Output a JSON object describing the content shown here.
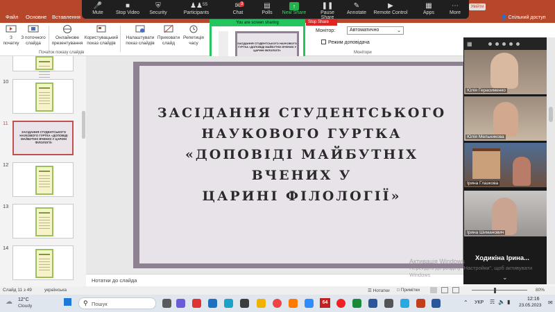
{
  "ribbon": {
    "tabs": [
      "Файл",
      "Основне",
      "Вставлення"
    ],
    "buttons": [
      {
        "label": "З початку"
      },
      {
        "label": "З поточного слайда"
      },
      {
        "label": "Онлайнове презентування"
      },
      {
        "label": "Користувацький показ слайдів"
      },
      {
        "label": "Налаштувати показ слайдів"
      },
      {
        "label": "Приховати слайд"
      },
      {
        "label": "Репетиція часу"
      }
    ],
    "group_start": "Початок показу слайдів",
    "monitor_label": "Монітор:",
    "monitor_value": "Автоматично",
    "presenter_view": "Режим доповідача",
    "group_monitors": "Монітори",
    "share_label": "Спільний доступ",
    "signin_label": "Увійти"
  },
  "zoom": {
    "items": [
      {
        "label": "Mute",
        "icon": "mic-icon"
      },
      {
        "label": "Stop Video",
        "icon": "camera-icon"
      },
      {
        "label": "Security",
        "icon": "shield-icon"
      },
      {
        "label": "Participants",
        "icon": "people-icon",
        "count": "55"
      },
      {
        "label": "Chat",
        "icon": "chat-icon",
        "count": "3"
      },
      {
        "label": "Polls",
        "icon": "polls-icon"
      },
      {
        "label": "New Share",
        "icon": "share-icon"
      },
      {
        "label": "Pause Share",
        "icon": "pause-icon"
      },
      {
        "label": "Annotate",
        "icon": "pencil-icon"
      },
      {
        "label": "Remote Control",
        "icon": "remote-icon"
      },
      {
        "label": "Apps",
        "icon": "apps-icon"
      },
      {
        "label": "More",
        "icon": "more-icon"
      }
    ],
    "sharing_text": "You are screen sharing",
    "stop_share": "Stop Share"
  },
  "thumbnails": [
    {
      "num": "",
      "selected": false
    },
    {
      "num": "10",
      "selected": false
    },
    {
      "num": "11",
      "selected": true,
      "text": "ЗАСІДАННЯ СТУДЕНТСЬКОГО НАУКОВОГО ГУРТКА «ДОПОВІДІ МАЙБУТНІХ ВЧЕНИХ У ЦАРИНІ ФІЛОЛОГІЇ»"
    },
    {
      "num": "12",
      "selected": false
    },
    {
      "num": "13",
      "selected": false
    },
    {
      "num": "14",
      "selected": false
    }
  ],
  "slide": {
    "line1": "ЗАСІДАННЯ СТУДЕНТСЬКОГО",
    "line2": "НАУКОВОГО ГУРТКА",
    "line3": "«ДОПОВІДІ МАЙБУТНІХ ВЧЕНИХ У",
    "line4": "ЦАРИНІ ФІЛОЛОГІЇ»"
  },
  "notes_placeholder": "Нотатки до слайда",
  "participants": [
    {
      "name": "Юлія Герасименко"
    },
    {
      "name": "Юлія Мельникова"
    },
    {
      "name": "Ірина Глазкова"
    },
    {
      "name": "Ірина Шиманович"
    }
  ],
  "speaker_name": "Ходикіна Ірина...",
  "status": {
    "slide_info": "Слайд 11 з 49",
    "language": "українська",
    "notes_btn": "Нотатки",
    "comments_btn": "Примітки",
    "zoom": "80%"
  },
  "watermark": {
    "line1": "Активація Windows",
    "line2": "Перейдіть до розділу \"Настройки\", щоб активувати",
    "line3": "Windows"
  },
  "taskbar": {
    "weather_temp": "12°C",
    "weather_desc": "Cloudy",
    "search_placeholder": "Пошук",
    "lang": "УКР",
    "time": "12:16",
    "date": "23.05.2023",
    "badge": "64"
  }
}
